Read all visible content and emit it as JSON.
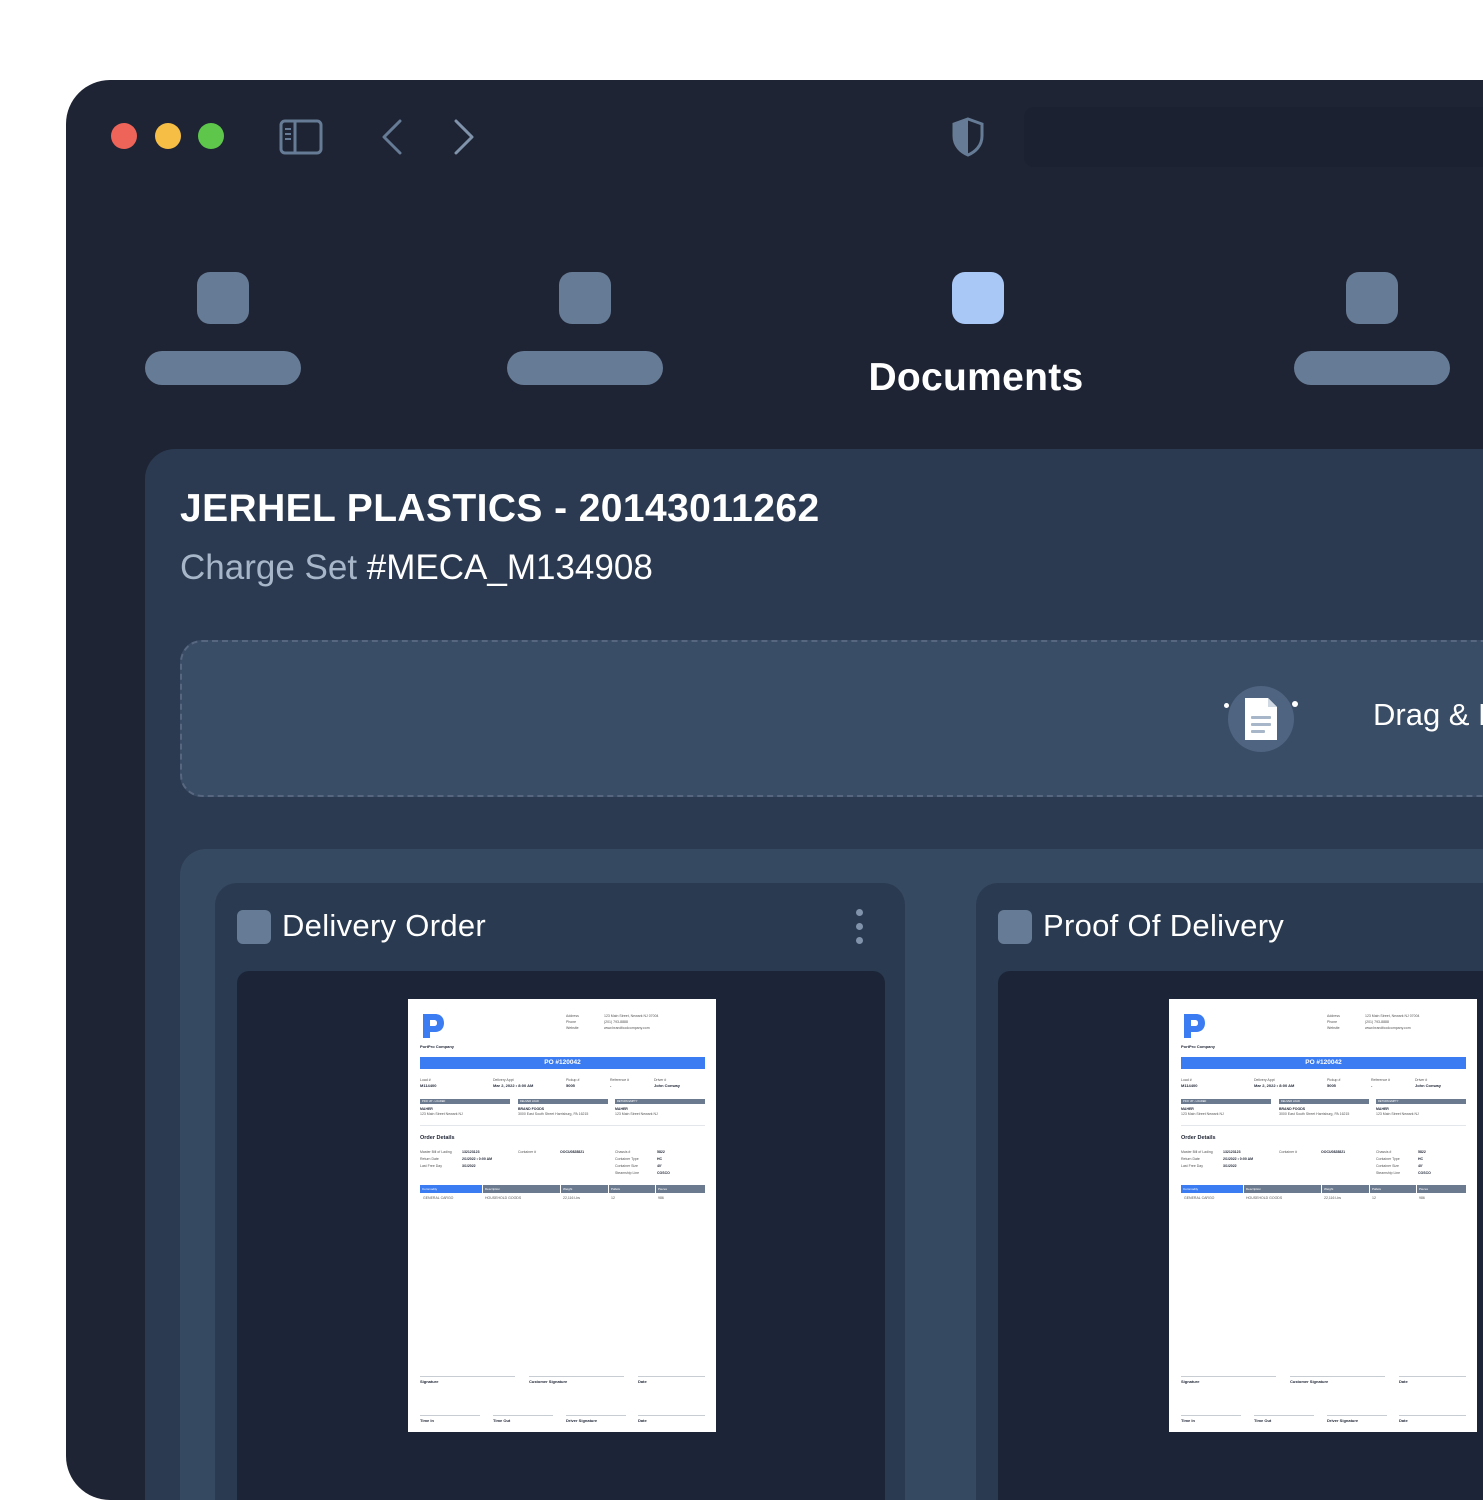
{
  "window": {
    "traffic_lights": {
      "close": "#ee6459",
      "minimize": "#f7be45",
      "maximize": "#5ec64b"
    },
    "toolbar_icons": [
      "sidebar-icon",
      "chevron-left-icon",
      "chevron-right-icon",
      "shield-icon"
    ]
  },
  "tabs": {
    "active_label": "Documents",
    "active_color": "#a9c8f6",
    "inactive_color": "#667b95"
  },
  "panel": {
    "title": "JERHEL PLASTICS - 20143011262",
    "subtitle_prefix": "Charge Set",
    "subtitle_value": "#MECA_M134908",
    "dropzone_text": "Drag & Drop"
  },
  "cards": [
    {
      "title": "Delivery Order"
    },
    {
      "title": "Proof Of Delivery"
    }
  ],
  "document_preview": {
    "company": "PortPro Company",
    "address_label": "Address",
    "address_value": "123 Main Street, Newark NJ 07004",
    "phone_label": "Phone",
    "phone_value": "(201) 793-8888",
    "website_label": "Website",
    "website_value": "www.brandfoodcompany.com",
    "po": "PO #120042",
    "meta": [
      {
        "label": "Load #",
        "value": "M114400"
      },
      {
        "label": "Delivery Appt",
        "value": "Mar 2, 2022 • 8:00 AM"
      },
      {
        "label": "Pickup #",
        "value": "5005"
      },
      {
        "label": "Reference #",
        "value": "-"
      },
      {
        "label": "Driver #",
        "value": "John Conway"
      }
    ],
    "groups": [
      {
        "header": "PICK UP - LOADED",
        "name": "MAHER",
        "addr": "123 Main Street Newark NJ"
      },
      {
        "header": "DELIVER LOAD",
        "name": "BRAND FOODS",
        "addr": "3000 East South Street Harrisburg, PA 16215"
      },
      {
        "header": "RETURN EMPTY",
        "name": "MAHER",
        "addr": "123 Main Street Newark NJ"
      }
    ],
    "order_details_title": "Order Details",
    "order_left": [
      {
        "label": "Master Bill of Lading",
        "value": "132123123"
      },
      {
        "label": "Return Date",
        "value": "2/1/2022 • 0:00 AM"
      },
      {
        "label": "Last Free Day",
        "value": "3/1/2022"
      }
    ],
    "container_label": "Container #",
    "container_value": "OOCU0828821",
    "order_right": [
      {
        "label": "Chassis #",
        "value": "5822"
      },
      {
        "label": "Container Type",
        "value": "HC"
      },
      {
        "label": "Container Size",
        "value": "40'"
      },
      {
        "label": "Steamship Line",
        "value": "COSCO"
      }
    ],
    "table_headers": [
      "Commodity",
      "Description",
      "Weight",
      "Pallets",
      "Pieces"
    ],
    "table_row": [
      "GENERAL CARGO",
      "HOUSEHOLD GOODS",
      "22,116 Lbs",
      "12",
      "986"
    ],
    "signatures_row1": [
      "Signature",
      "Customer Signature",
      "Date"
    ],
    "signatures_row2": [
      "Time In",
      "Time Out",
      "Driver Signature",
      "Date"
    ]
  }
}
